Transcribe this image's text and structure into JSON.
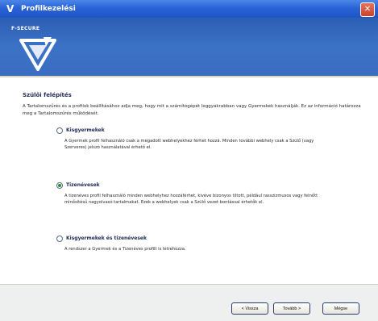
{
  "window": {
    "title": "Profilkezelési",
    "close_symbol": "✕",
    "title_icon": "v-logo-icon"
  },
  "banner": {
    "brand": "F-SECURE",
    "logo_icon": "v-shield-logo"
  },
  "content": {
    "heading": "Szülői felépítés",
    "intro": "A Tartalomszűrés és a profilok beállításához adja meg, hogy mit a számítógépét leggyakrabban vagy Gyermekek használják. Ez az információ határozza meg a Tartalomszűrés működését.",
    "options": [
      {
        "label": "Kisgyermekek",
        "description": "A Gyermek profil felhasználó csak a megadott webhelyekhez férhet hozzá. Minden további webhely csak a Szülő (vagy Szerveres) jelszó használatával érhető el.",
        "selected": false
      },
      {
        "label": "Tizenévesek",
        "description": "A tizenéves profil felhasználó minden webhelyhez hozzáférhet, kivéve bizonyos tiltott, például rasszizmusos vagy felnőtt minősítésű nagyolvasó tartalmakat. Ezek a webhelyek csak a Szülő vezet bontással érhetők el.",
        "selected": true
      },
      {
        "label": "Kisgyermekek és tizenévesek",
        "description": "A rendszer a Gyermek és a Tizenéves profilt is létrehozza.",
        "selected": false
      }
    ]
  },
  "footer": {
    "back": "< Vissza",
    "next": "Tovább >",
    "cancel": "Mégse"
  }
}
